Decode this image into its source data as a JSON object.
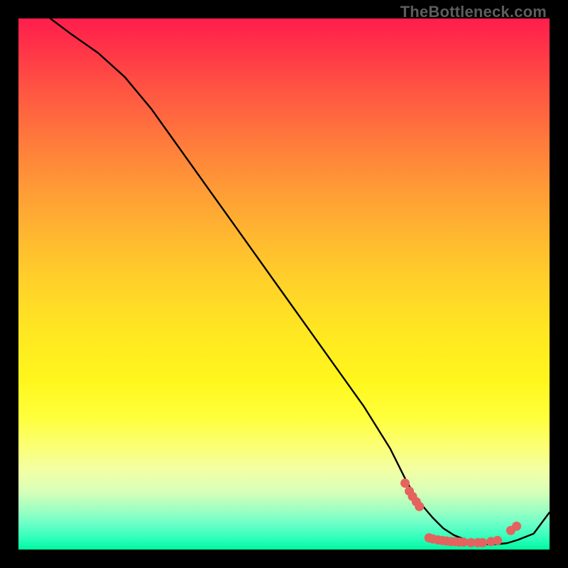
{
  "watermark": "TheBottleneck.com",
  "chart_data": {
    "type": "line",
    "title": "",
    "xlabel": "",
    "ylabel": "",
    "xlim": [
      0,
      100
    ],
    "ylim": [
      0,
      100
    ],
    "grid": false,
    "legend": false,
    "background_gradient": {
      "top": "#ff1e4c",
      "mid": "#ffff3a",
      "bottom": "#00f7a0"
    },
    "series": [
      {
        "name": "curve",
        "color": "#000000",
        "x": [
          6,
          10,
          15,
          20,
          25,
          30,
          35,
          40,
          45,
          50,
          55,
          60,
          65,
          70,
          73,
          75,
          78,
          80,
          82,
          85,
          88,
          90,
          92,
          94,
          97,
          100
        ],
        "y": [
          100,
          97,
          93.5,
          89,
          83,
          76,
          69,
          62,
          55,
          48,
          41,
          34,
          27,
          19,
          13,
          9.5,
          6,
          4,
          2.7,
          1.5,
          1,
          1,
          1.2,
          1.8,
          3,
          7
        ]
      }
    ],
    "marker_points": {
      "name": "dots",
      "color": "#e4635f",
      "points": [
        {
          "x": 72.8,
          "y": 12.5
        },
        {
          "x": 73.6,
          "y": 11.0
        },
        {
          "x": 74.2,
          "y": 10.0
        },
        {
          "x": 74.9,
          "y": 9.0
        },
        {
          "x": 75.5,
          "y": 8.1
        },
        {
          "x": 77.3,
          "y": 2.2
        },
        {
          "x": 78.0,
          "y": 2.0
        },
        {
          "x": 79.0,
          "y": 1.8
        },
        {
          "x": 79.8,
          "y": 1.7
        },
        {
          "x": 80.6,
          "y": 1.6
        },
        {
          "x": 81.4,
          "y": 1.5
        },
        {
          "x": 82.2,
          "y": 1.5
        },
        {
          "x": 83.0,
          "y": 1.4
        },
        {
          "x": 83.8,
          "y": 1.4
        },
        {
          "x": 85.2,
          "y": 1.3
        },
        {
          "x": 86.5,
          "y": 1.3
        },
        {
          "x": 87.4,
          "y": 1.3
        },
        {
          "x": 89.0,
          "y": 1.5
        },
        {
          "x": 90.2,
          "y": 1.7
        },
        {
          "x": 92.7,
          "y": 3.6
        },
        {
          "x": 93.8,
          "y": 4.4
        }
      ]
    }
  }
}
